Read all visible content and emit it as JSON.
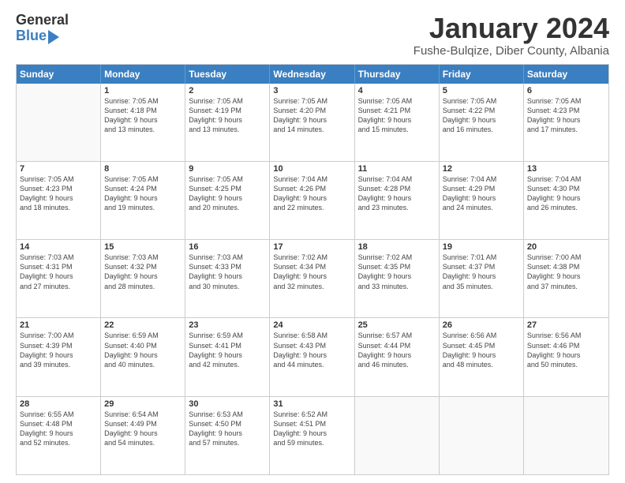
{
  "logo": {
    "line1": "General",
    "line2": "Blue"
  },
  "header": {
    "month": "January 2024",
    "location": "Fushe-Bulqize, Diber County, Albania"
  },
  "days": [
    "Sunday",
    "Monday",
    "Tuesday",
    "Wednesday",
    "Thursday",
    "Friday",
    "Saturday"
  ],
  "weeks": [
    [
      {
        "day": "",
        "sunrise": "",
        "sunset": "",
        "daylight": ""
      },
      {
        "day": "1",
        "sunrise": "Sunrise: 7:05 AM",
        "sunset": "Sunset: 4:18 PM",
        "daylight": "Daylight: 9 hours and 13 minutes."
      },
      {
        "day": "2",
        "sunrise": "Sunrise: 7:05 AM",
        "sunset": "Sunset: 4:19 PM",
        "daylight": "Daylight: 9 hours and 13 minutes."
      },
      {
        "day": "3",
        "sunrise": "Sunrise: 7:05 AM",
        "sunset": "Sunset: 4:20 PM",
        "daylight": "Daylight: 9 hours and 14 minutes."
      },
      {
        "day": "4",
        "sunrise": "Sunrise: 7:05 AM",
        "sunset": "Sunset: 4:21 PM",
        "daylight": "Daylight: 9 hours and 15 minutes."
      },
      {
        "day": "5",
        "sunrise": "Sunrise: 7:05 AM",
        "sunset": "Sunset: 4:22 PM",
        "daylight": "Daylight: 9 hours and 16 minutes."
      },
      {
        "day": "6",
        "sunrise": "Sunrise: 7:05 AM",
        "sunset": "Sunset: 4:23 PM",
        "daylight": "Daylight: 9 hours and 17 minutes."
      }
    ],
    [
      {
        "day": "7",
        "sunrise": "Sunrise: 7:05 AM",
        "sunset": "Sunset: 4:23 PM",
        "daylight": "Daylight: 9 hours and 18 minutes."
      },
      {
        "day": "8",
        "sunrise": "Sunrise: 7:05 AM",
        "sunset": "Sunset: 4:24 PM",
        "daylight": "Daylight: 9 hours and 19 minutes."
      },
      {
        "day": "9",
        "sunrise": "Sunrise: 7:05 AM",
        "sunset": "Sunset: 4:25 PM",
        "daylight": "Daylight: 9 hours and 20 minutes."
      },
      {
        "day": "10",
        "sunrise": "Sunrise: 7:04 AM",
        "sunset": "Sunset: 4:26 PM",
        "daylight": "Daylight: 9 hours and 22 minutes."
      },
      {
        "day": "11",
        "sunrise": "Sunrise: 7:04 AM",
        "sunset": "Sunset: 4:28 PM",
        "daylight": "Daylight: 9 hours and 23 minutes."
      },
      {
        "day": "12",
        "sunrise": "Sunrise: 7:04 AM",
        "sunset": "Sunset: 4:29 PM",
        "daylight": "Daylight: 9 hours and 24 minutes."
      },
      {
        "day": "13",
        "sunrise": "Sunrise: 7:04 AM",
        "sunset": "Sunset: 4:30 PM",
        "daylight": "Daylight: 9 hours and 26 minutes."
      }
    ],
    [
      {
        "day": "14",
        "sunrise": "Sunrise: 7:03 AM",
        "sunset": "Sunset: 4:31 PM",
        "daylight": "Daylight: 9 hours and 27 minutes."
      },
      {
        "day": "15",
        "sunrise": "Sunrise: 7:03 AM",
        "sunset": "Sunset: 4:32 PM",
        "daylight": "Daylight: 9 hours and 28 minutes."
      },
      {
        "day": "16",
        "sunrise": "Sunrise: 7:03 AM",
        "sunset": "Sunset: 4:33 PM",
        "daylight": "Daylight: 9 hours and 30 minutes."
      },
      {
        "day": "17",
        "sunrise": "Sunrise: 7:02 AM",
        "sunset": "Sunset: 4:34 PM",
        "daylight": "Daylight: 9 hours and 32 minutes."
      },
      {
        "day": "18",
        "sunrise": "Sunrise: 7:02 AM",
        "sunset": "Sunset: 4:35 PM",
        "daylight": "Daylight: 9 hours and 33 minutes."
      },
      {
        "day": "19",
        "sunrise": "Sunrise: 7:01 AM",
        "sunset": "Sunset: 4:37 PM",
        "daylight": "Daylight: 9 hours and 35 minutes."
      },
      {
        "day": "20",
        "sunrise": "Sunrise: 7:00 AM",
        "sunset": "Sunset: 4:38 PM",
        "daylight": "Daylight: 9 hours and 37 minutes."
      }
    ],
    [
      {
        "day": "21",
        "sunrise": "Sunrise: 7:00 AM",
        "sunset": "Sunset: 4:39 PM",
        "daylight": "Daylight: 9 hours and 39 minutes."
      },
      {
        "day": "22",
        "sunrise": "Sunrise: 6:59 AM",
        "sunset": "Sunset: 4:40 PM",
        "daylight": "Daylight: 9 hours and 40 minutes."
      },
      {
        "day": "23",
        "sunrise": "Sunrise: 6:59 AM",
        "sunset": "Sunset: 4:41 PM",
        "daylight": "Daylight: 9 hours and 42 minutes."
      },
      {
        "day": "24",
        "sunrise": "Sunrise: 6:58 AM",
        "sunset": "Sunset: 4:43 PM",
        "daylight": "Daylight: 9 hours and 44 minutes."
      },
      {
        "day": "25",
        "sunrise": "Sunrise: 6:57 AM",
        "sunset": "Sunset: 4:44 PM",
        "daylight": "Daylight: 9 hours and 46 minutes."
      },
      {
        "day": "26",
        "sunrise": "Sunrise: 6:56 AM",
        "sunset": "Sunset: 4:45 PM",
        "daylight": "Daylight: 9 hours and 48 minutes."
      },
      {
        "day": "27",
        "sunrise": "Sunrise: 6:56 AM",
        "sunset": "Sunset: 4:46 PM",
        "daylight": "Daylight: 9 hours and 50 minutes."
      }
    ],
    [
      {
        "day": "28",
        "sunrise": "Sunrise: 6:55 AM",
        "sunset": "Sunset: 4:48 PM",
        "daylight": "Daylight: 9 hours and 52 minutes."
      },
      {
        "day": "29",
        "sunrise": "Sunrise: 6:54 AM",
        "sunset": "Sunset: 4:49 PM",
        "daylight": "Daylight: 9 hours and 54 minutes."
      },
      {
        "day": "30",
        "sunrise": "Sunrise: 6:53 AM",
        "sunset": "Sunset: 4:50 PM",
        "daylight": "Daylight: 9 hours and 57 minutes."
      },
      {
        "day": "31",
        "sunrise": "Sunrise: 6:52 AM",
        "sunset": "Sunset: 4:51 PM",
        "daylight": "Daylight: 9 hours and 59 minutes."
      },
      {
        "day": "",
        "sunrise": "",
        "sunset": "",
        "daylight": ""
      },
      {
        "day": "",
        "sunrise": "",
        "sunset": "",
        "daylight": ""
      },
      {
        "day": "",
        "sunrise": "",
        "sunset": "",
        "daylight": ""
      }
    ]
  ]
}
